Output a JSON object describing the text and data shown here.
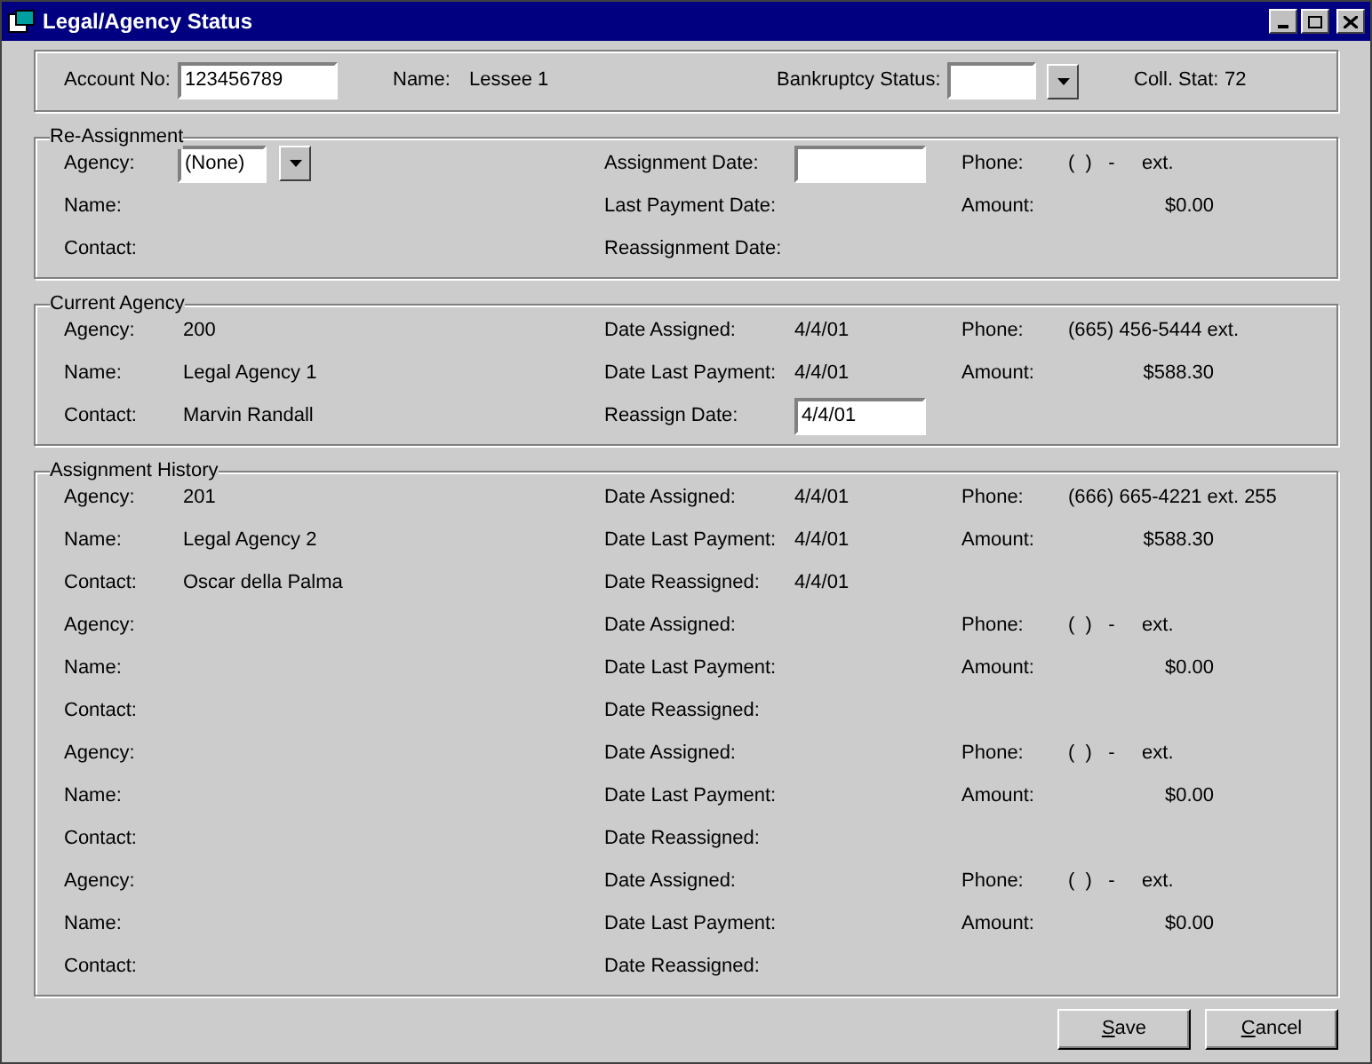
{
  "window": {
    "title": "Legal/Agency Status"
  },
  "header": {
    "account_no": {
      "label": "Account No:",
      "value": "123456789"
    },
    "name": {
      "label": "Name:",
      "value": "Lessee 1"
    },
    "bankruptcy": {
      "label": "Bankruptcy Status:"
    },
    "coll_stat": {
      "label": "Coll. Stat:",
      "value": "72"
    }
  },
  "sections": [
    {
      "title": "Re-Assignment",
      "rows": [
        [
          {
            "label": "Agency:",
            "kind": "dropdown",
            "value": "(None)"
          },
          {
            "label": "Assignment Date:",
            "kind": "field"
          },
          {
            "label": "Phone:",
            "kind": "text",
            "value": "(  )   -     ext."
          }
        ],
        [
          {
            "label": "Name:",
            "kind": "text"
          },
          {
            "label": "Last Payment Date:",
            "kind": "text"
          },
          {
            "label": "Amount:",
            "kind": "amount",
            "value": "$0.00"
          }
        ],
        [
          {
            "label": "Contact:",
            "kind": "text"
          },
          {
            "label": "Reassignment Date:",
            "kind": "text"
          }
        ]
      ]
    },
    {
      "title": "Current Agency",
      "rows": [
        [
          {
            "label": "Agency:",
            "kind": "text",
            "value": "200"
          },
          {
            "label": "Date Assigned:",
            "kind": "text",
            "value": "4/4/01"
          },
          {
            "label": "Phone:",
            "kind": "text",
            "value": "(665) 456-5444 ext."
          }
        ],
        [
          {
            "label": "Name:",
            "kind": "text",
            "value": "Legal Agency 1"
          },
          {
            "label": "Date Last Payment:",
            "kind": "text",
            "value": "4/4/01"
          },
          {
            "label": "Amount:",
            "kind": "amount",
            "value": "$588.30"
          }
        ],
        [
          {
            "label": "Contact:",
            "kind": "text",
            "value": "Marvin Randall"
          },
          {
            "label": "Reassign Date:",
            "kind": "field",
            "value": "4/4/01"
          }
        ]
      ]
    },
    {
      "title": "Assignment History",
      "rows": [
        [
          {
            "label": "Agency:",
            "kind": "text",
            "value": "201"
          },
          {
            "label": "Date Assigned:",
            "kind": "text",
            "value": "4/4/01"
          },
          {
            "label": "Phone:",
            "kind": "text",
            "value": "(666) 665-4221 ext. 255"
          }
        ],
        [
          {
            "label": "Name:",
            "kind": "text",
            "value": "Legal Agency 2"
          },
          {
            "label": "Date Last Payment:",
            "kind": "text",
            "value": "4/4/01"
          },
          {
            "label": "Amount:",
            "kind": "amount",
            "value": "$588.30"
          }
        ],
        [
          {
            "label": "Contact:",
            "kind": "text",
            "value": "Oscar della Palma"
          },
          {
            "label": "Date Reassigned:",
            "kind": "text",
            "value": "4/4/01"
          }
        ],
        [
          {
            "label": "Agency:",
            "kind": "text"
          },
          {
            "label": "Date Assigned:",
            "kind": "text"
          },
          {
            "label": "Phone:",
            "kind": "text",
            "value": "(  )   -     ext."
          }
        ],
        [
          {
            "label": "Name:",
            "kind": "text"
          },
          {
            "label": "Date Last Payment:",
            "kind": "text"
          },
          {
            "label": "Amount:",
            "kind": "amount",
            "value": "$0.00"
          }
        ],
        [
          {
            "label": "Contact:",
            "kind": "text"
          },
          {
            "label": "Date Reassigned:",
            "kind": "text"
          }
        ],
        [
          {
            "label": "Agency:",
            "kind": "text"
          },
          {
            "label": "Date Assigned:",
            "kind": "text"
          },
          {
            "label": "Phone:",
            "kind": "text",
            "value": "(  )   -     ext."
          }
        ],
        [
          {
            "label": "Name:",
            "kind": "text"
          },
          {
            "label": "Date Last Payment:",
            "kind": "text"
          },
          {
            "label": "Amount:",
            "kind": "amount",
            "value": "$0.00"
          }
        ],
        [
          {
            "label": "Contact:",
            "kind": "text"
          },
          {
            "label": "Date Reassigned:",
            "kind": "text"
          }
        ],
        [
          {
            "label": "Agency:",
            "kind": "text"
          },
          {
            "label": "Date Assigned:",
            "kind": "text"
          },
          {
            "label": "Phone:",
            "kind": "text",
            "value": "(  )   -     ext."
          }
        ],
        [
          {
            "label": "Name:",
            "kind": "text"
          },
          {
            "label": "Date Last Payment:",
            "kind": "text"
          },
          {
            "label": "Amount:",
            "kind": "amount",
            "value": "$0.00"
          }
        ],
        [
          {
            "label": "Contact:",
            "kind": "text"
          },
          {
            "label": "Date Reassigned:",
            "kind": "text"
          }
        ]
      ]
    }
  ],
  "buttons": [
    {
      "accel": "S",
      "rest": "ave"
    },
    {
      "accel": "C",
      "rest": "ancel"
    }
  ]
}
